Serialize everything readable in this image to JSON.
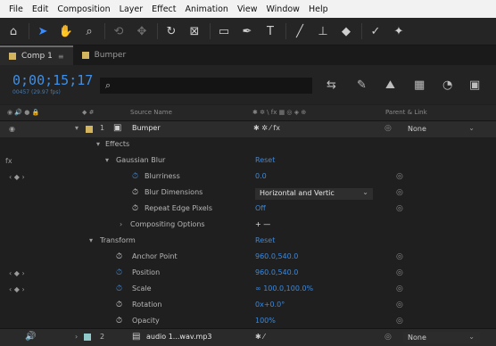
{
  "menu": [
    "File",
    "Edit",
    "Composition",
    "Layer",
    "Effect",
    "Animation",
    "View",
    "Window",
    "Help"
  ],
  "toolbar": {
    "tools": [
      {
        "name": "home-icon",
        "glyph": "⌂"
      },
      {
        "name": "selection-tool-icon",
        "glyph": "➤"
      },
      {
        "name": "hand-tool-icon",
        "glyph": "✋"
      },
      {
        "name": "zoom-tool-icon",
        "glyph": "🔍"
      },
      {
        "name": "orbit-tool-icon",
        "glyph": "⟲"
      },
      {
        "name": "pan-behind-tool-icon",
        "glyph": "✥"
      },
      {
        "name": "rotate-tool-icon",
        "glyph": "↻"
      },
      {
        "name": "camera-tool-icon",
        "glyph": "⊡"
      },
      {
        "name": "rectangle-tool-icon",
        "glyph": "▭"
      },
      {
        "name": "pen-tool-icon",
        "glyph": "✒"
      },
      {
        "name": "type-tool-icon",
        "glyph": "T"
      },
      {
        "name": "brush-tool-icon",
        "glyph": "╱"
      },
      {
        "name": "clone-stamp-tool-icon",
        "glyph": "⊥"
      },
      {
        "name": "eraser-tool-icon",
        "glyph": "◆"
      },
      {
        "name": "roto-brush-tool-icon",
        "glyph": "✓"
      },
      {
        "name": "puppet-pin-tool-icon",
        "glyph": "✦"
      }
    ]
  },
  "tabs": [
    {
      "label": "Comp 1",
      "close": "≡",
      "color": "#d4b860"
    },
    {
      "label": "Bumper",
      "color": "#d4b860"
    }
  ],
  "header": {
    "timecode": "0;00;15;17",
    "fps": "00457 (29.97 fps)",
    "search_icon": "search-icon"
  },
  "columns": [
    "Source Name",
    "Parent & Link"
  ],
  "rows": [
    {
      "type": "layer",
      "num": "1",
      "name": "Bumper",
      "parent": "None"
    },
    {
      "type": "group",
      "label": "Effects"
    },
    {
      "type": "effect",
      "label": "Gaussian Blur",
      "value": "Reset"
    },
    {
      "type": "prop",
      "label": "Blurriness",
      "value": "0.0"
    },
    {
      "type": "prop",
      "label": "Blur Dimensions",
      "value": "Horizontal and Vertic"
    },
    {
      "type": "prop",
      "label": "Repeat Edge Pixels",
      "value": "Off"
    },
    {
      "type": "prop",
      "label": "Compositing Options",
      "value": "+ —"
    },
    {
      "type": "group",
      "label": "Transform",
      "value": "Reset"
    },
    {
      "type": "prop",
      "label": "Anchor Point",
      "value": "960.0,540.0"
    },
    {
      "type": "prop",
      "label": "Position",
      "value": "960.0,540.0"
    },
    {
      "type": "prop",
      "label": "Scale",
      "value": "∞ 100.0,100.0%"
    },
    {
      "type": "prop",
      "label": "Rotation",
      "value": "0x+0.0°"
    },
    {
      "type": "prop",
      "label": "Opacity",
      "value": "100%"
    }
  ],
  "bottom_layer": {
    "num": "2",
    "name": "audio 1...wav.mp3",
    "parent": "None"
  }
}
